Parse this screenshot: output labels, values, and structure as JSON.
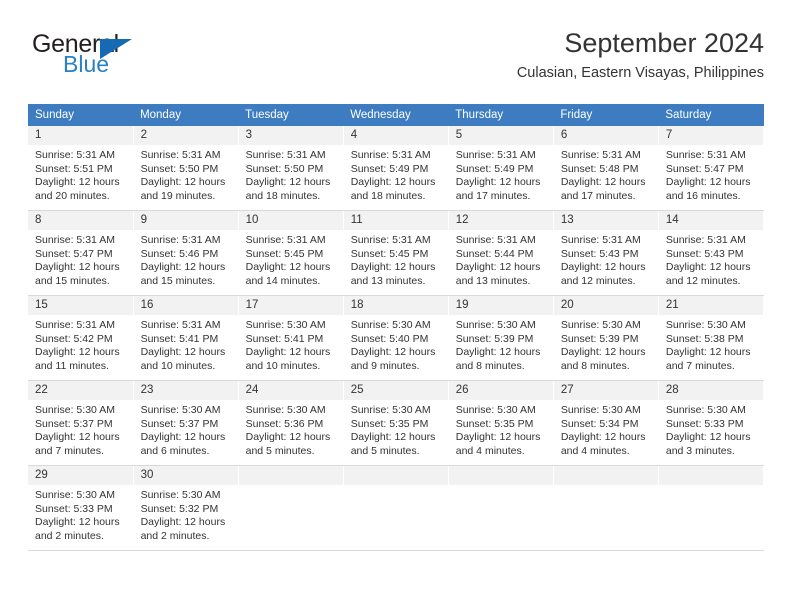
{
  "brand": {
    "name_part1": "General",
    "name_part2": "Blue",
    "triangle_color": "#1669b3",
    "blue_color": "#2980c4"
  },
  "header": {
    "title": "September 2024",
    "subtitle": "Culasian, Eastern Visayas, Philippines"
  },
  "theme": {
    "header_row_bg": "#3d7cc0",
    "header_row_text": "#ffffff",
    "day_number_bg": "#f2f2f2",
    "cell_border": "#d9d9d9",
    "text": "#333333"
  },
  "weekday_headers": [
    "Sunday",
    "Monday",
    "Tuesday",
    "Wednesday",
    "Thursday",
    "Friday",
    "Saturday"
  ],
  "weeks": [
    [
      {
        "day": "1",
        "sunrise": "Sunrise: 5:31 AM",
        "sunset": "Sunset: 5:51 PM",
        "daylight1": "Daylight: 12 hours",
        "daylight2": "and 20 minutes."
      },
      {
        "day": "2",
        "sunrise": "Sunrise: 5:31 AM",
        "sunset": "Sunset: 5:50 PM",
        "daylight1": "Daylight: 12 hours",
        "daylight2": "and 19 minutes."
      },
      {
        "day": "3",
        "sunrise": "Sunrise: 5:31 AM",
        "sunset": "Sunset: 5:50 PM",
        "daylight1": "Daylight: 12 hours",
        "daylight2": "and 18 minutes."
      },
      {
        "day": "4",
        "sunrise": "Sunrise: 5:31 AM",
        "sunset": "Sunset: 5:49 PM",
        "daylight1": "Daylight: 12 hours",
        "daylight2": "and 18 minutes."
      },
      {
        "day": "5",
        "sunrise": "Sunrise: 5:31 AM",
        "sunset": "Sunset: 5:49 PM",
        "daylight1": "Daylight: 12 hours",
        "daylight2": "and 17 minutes."
      },
      {
        "day": "6",
        "sunrise": "Sunrise: 5:31 AM",
        "sunset": "Sunset: 5:48 PM",
        "daylight1": "Daylight: 12 hours",
        "daylight2": "and 17 minutes."
      },
      {
        "day": "7",
        "sunrise": "Sunrise: 5:31 AM",
        "sunset": "Sunset: 5:47 PM",
        "daylight1": "Daylight: 12 hours",
        "daylight2": "and 16 minutes."
      }
    ],
    [
      {
        "day": "8",
        "sunrise": "Sunrise: 5:31 AM",
        "sunset": "Sunset: 5:47 PM",
        "daylight1": "Daylight: 12 hours",
        "daylight2": "and 15 minutes."
      },
      {
        "day": "9",
        "sunrise": "Sunrise: 5:31 AM",
        "sunset": "Sunset: 5:46 PM",
        "daylight1": "Daylight: 12 hours",
        "daylight2": "and 15 minutes."
      },
      {
        "day": "10",
        "sunrise": "Sunrise: 5:31 AM",
        "sunset": "Sunset: 5:45 PM",
        "daylight1": "Daylight: 12 hours",
        "daylight2": "and 14 minutes."
      },
      {
        "day": "11",
        "sunrise": "Sunrise: 5:31 AM",
        "sunset": "Sunset: 5:45 PM",
        "daylight1": "Daylight: 12 hours",
        "daylight2": "and 13 minutes."
      },
      {
        "day": "12",
        "sunrise": "Sunrise: 5:31 AM",
        "sunset": "Sunset: 5:44 PM",
        "daylight1": "Daylight: 12 hours",
        "daylight2": "and 13 minutes."
      },
      {
        "day": "13",
        "sunrise": "Sunrise: 5:31 AM",
        "sunset": "Sunset: 5:43 PM",
        "daylight1": "Daylight: 12 hours",
        "daylight2": "and 12 minutes."
      },
      {
        "day": "14",
        "sunrise": "Sunrise: 5:31 AM",
        "sunset": "Sunset: 5:43 PM",
        "daylight1": "Daylight: 12 hours",
        "daylight2": "and 12 minutes."
      }
    ],
    [
      {
        "day": "15",
        "sunrise": "Sunrise: 5:31 AM",
        "sunset": "Sunset: 5:42 PM",
        "daylight1": "Daylight: 12 hours",
        "daylight2": "and 11 minutes."
      },
      {
        "day": "16",
        "sunrise": "Sunrise: 5:31 AM",
        "sunset": "Sunset: 5:41 PM",
        "daylight1": "Daylight: 12 hours",
        "daylight2": "and 10 minutes."
      },
      {
        "day": "17",
        "sunrise": "Sunrise: 5:30 AM",
        "sunset": "Sunset: 5:41 PM",
        "daylight1": "Daylight: 12 hours",
        "daylight2": "and 10 minutes."
      },
      {
        "day": "18",
        "sunrise": "Sunrise: 5:30 AM",
        "sunset": "Sunset: 5:40 PM",
        "daylight1": "Daylight: 12 hours",
        "daylight2": "and 9 minutes."
      },
      {
        "day": "19",
        "sunrise": "Sunrise: 5:30 AM",
        "sunset": "Sunset: 5:39 PM",
        "daylight1": "Daylight: 12 hours",
        "daylight2": "and 8 minutes."
      },
      {
        "day": "20",
        "sunrise": "Sunrise: 5:30 AM",
        "sunset": "Sunset: 5:39 PM",
        "daylight1": "Daylight: 12 hours",
        "daylight2": "and 8 minutes."
      },
      {
        "day": "21",
        "sunrise": "Sunrise: 5:30 AM",
        "sunset": "Sunset: 5:38 PM",
        "daylight1": "Daylight: 12 hours",
        "daylight2": "and 7 minutes."
      }
    ],
    [
      {
        "day": "22",
        "sunrise": "Sunrise: 5:30 AM",
        "sunset": "Sunset: 5:37 PM",
        "daylight1": "Daylight: 12 hours",
        "daylight2": "and 7 minutes."
      },
      {
        "day": "23",
        "sunrise": "Sunrise: 5:30 AM",
        "sunset": "Sunset: 5:37 PM",
        "daylight1": "Daylight: 12 hours",
        "daylight2": "and 6 minutes."
      },
      {
        "day": "24",
        "sunrise": "Sunrise: 5:30 AM",
        "sunset": "Sunset: 5:36 PM",
        "daylight1": "Daylight: 12 hours",
        "daylight2": "and 5 minutes."
      },
      {
        "day": "25",
        "sunrise": "Sunrise: 5:30 AM",
        "sunset": "Sunset: 5:35 PM",
        "daylight1": "Daylight: 12 hours",
        "daylight2": "and 5 minutes."
      },
      {
        "day": "26",
        "sunrise": "Sunrise: 5:30 AM",
        "sunset": "Sunset: 5:35 PM",
        "daylight1": "Daylight: 12 hours",
        "daylight2": "and 4 minutes."
      },
      {
        "day": "27",
        "sunrise": "Sunrise: 5:30 AM",
        "sunset": "Sunset: 5:34 PM",
        "daylight1": "Daylight: 12 hours",
        "daylight2": "and 4 minutes."
      },
      {
        "day": "28",
        "sunrise": "Sunrise: 5:30 AM",
        "sunset": "Sunset: 5:33 PM",
        "daylight1": "Daylight: 12 hours",
        "daylight2": "and 3 minutes."
      }
    ],
    [
      {
        "day": "29",
        "sunrise": "Sunrise: 5:30 AM",
        "sunset": "Sunset: 5:33 PM",
        "daylight1": "Daylight: 12 hours",
        "daylight2": "and 2 minutes."
      },
      {
        "day": "30",
        "sunrise": "Sunrise: 5:30 AM",
        "sunset": "Sunset: 5:32 PM",
        "daylight1": "Daylight: 12 hours",
        "daylight2": "and 2 minutes."
      },
      {
        "day": "",
        "sunrise": "",
        "sunset": "",
        "daylight1": "",
        "daylight2": ""
      },
      {
        "day": "",
        "sunrise": "",
        "sunset": "",
        "daylight1": "",
        "daylight2": ""
      },
      {
        "day": "",
        "sunrise": "",
        "sunset": "",
        "daylight1": "",
        "daylight2": ""
      },
      {
        "day": "",
        "sunrise": "",
        "sunset": "",
        "daylight1": "",
        "daylight2": ""
      },
      {
        "day": "",
        "sunrise": "",
        "sunset": "",
        "daylight1": "",
        "daylight2": ""
      }
    ]
  ]
}
